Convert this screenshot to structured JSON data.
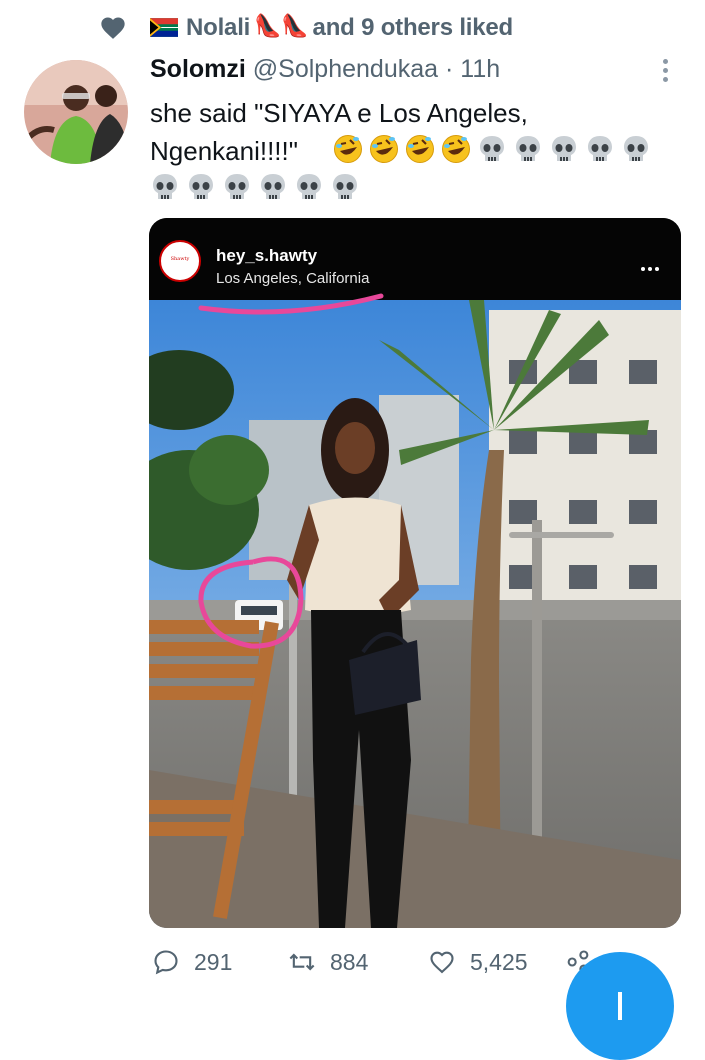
{
  "liked_by": {
    "name": "Nolali",
    "suffix": "and 9 others liked",
    "flag_icon": "south-africa-flag",
    "emoji": "high-heel"
  },
  "tweet": {
    "display_name": "Solomzi",
    "handle": "@Solphendukaa",
    "separator": "·",
    "time": "11h",
    "text_line1": "she said \"SIYAYA e Los Angeles,",
    "text_line2": "Ngenkani!!!!\"",
    "emoji_line2": [
      "rofl",
      "rofl",
      "rofl",
      "rofl",
      "skull",
      "skull",
      "skull",
      "skull",
      "skull"
    ],
    "emoji_line3": [
      "skull",
      "skull",
      "skull",
      "skull",
      "skull",
      "skull"
    ]
  },
  "media": {
    "ig_username": "hey_s.hawty",
    "ig_location": "Los Angeles, California",
    "ig_avatar_text": "Shawty",
    "annotation_color": "#e8489a"
  },
  "actions": {
    "replies": "291",
    "retweets": "884",
    "likes": "5,425"
  },
  "colors": {
    "accent": "#1d9bf0",
    "secondary_text": "#536471"
  }
}
